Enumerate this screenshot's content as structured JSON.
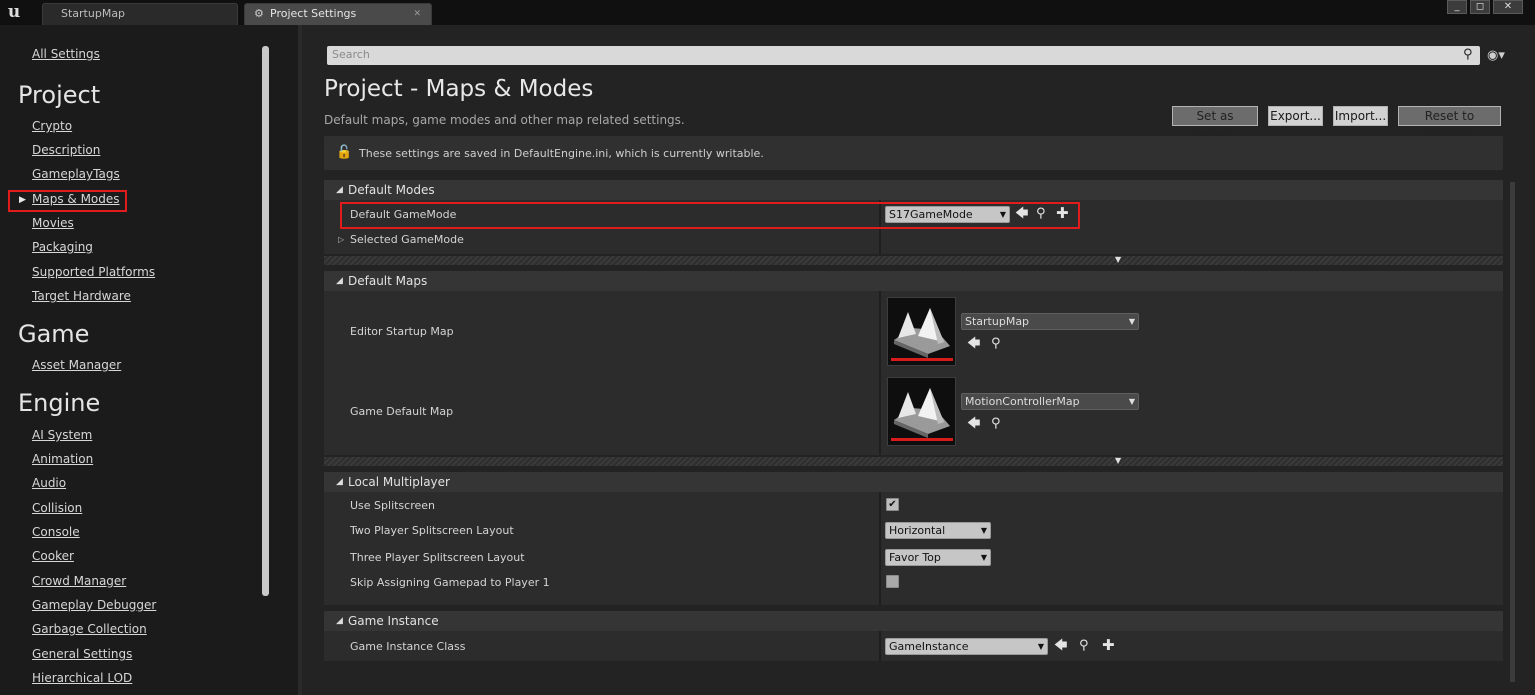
{
  "titlebar": {
    "logo_letter": "u",
    "tabs": [
      {
        "label": "StartupMap"
      },
      {
        "label": "Project Settings"
      }
    ],
    "window_buttons": [
      "_",
      "◻",
      "✕"
    ]
  },
  "sidebar": {
    "all_settings": "All Settings",
    "categories": [
      {
        "title": "Project",
        "items": [
          "Crypto",
          "Description",
          "GameplayTags",
          "Maps & Modes",
          "Movies",
          "Packaging",
          "Supported Platforms",
          "Target Hardware"
        ]
      },
      {
        "title": "Game",
        "items": [
          "Asset Manager"
        ]
      },
      {
        "title": "Engine",
        "items": [
          "AI System",
          "Animation",
          "Audio",
          "Collision",
          "Console",
          "Cooker",
          "Crowd Manager",
          "Gameplay Debugger",
          "Garbage Collection",
          "General Settings",
          "Hierarchical LOD"
        ]
      }
    ],
    "selected_item": "Maps & Modes",
    "highlight_color": "#e01c1c"
  },
  "search": {
    "placeholder": "Search"
  },
  "page": {
    "title": "Project - Maps & Modes",
    "subtitle": "Default maps, game modes and other map related settings.",
    "buttons": {
      "set_default": "Set as Default",
      "export": "Export...",
      "import": "Import...",
      "reset": "Reset to Defaults"
    },
    "notice": "These settings are saved in DefaultEngine.ini, which is currently writable."
  },
  "sections": {
    "default_modes": {
      "title": "Default Modes",
      "default_gamemode_label": "Default GameMode",
      "default_gamemode_value": "S17GameMode",
      "selected_gamemode_label": "Selected GameMode"
    },
    "default_maps": {
      "title": "Default Maps",
      "editor_startup_label": "Editor Startup Map",
      "editor_startup_value": "StartupMap",
      "game_default_label": "Game Default Map",
      "game_default_value": "MotionControllerMap"
    },
    "local_multiplayer": {
      "title": "Local Multiplayer",
      "use_splitscreen_label": "Use Splitscreen",
      "use_splitscreen_checked": true,
      "two_player_label": "Two Player Splitscreen Layout",
      "two_player_value": "Horizontal",
      "three_player_label": "Three Player Splitscreen Layout",
      "three_player_value": "Favor Top",
      "skip_gamepad_label": "Skip Assigning Gamepad to Player 1",
      "skip_gamepad_checked": false
    },
    "game_instance": {
      "title": "Game Instance",
      "class_label": "Game Instance Class",
      "class_value": "GameInstance"
    }
  },
  "icons": {
    "use_selected": "arrow-left-icon",
    "browse": "search-icon",
    "create_new": "plus-icon",
    "lock": "lock-icon",
    "eye": "eye-icon"
  }
}
